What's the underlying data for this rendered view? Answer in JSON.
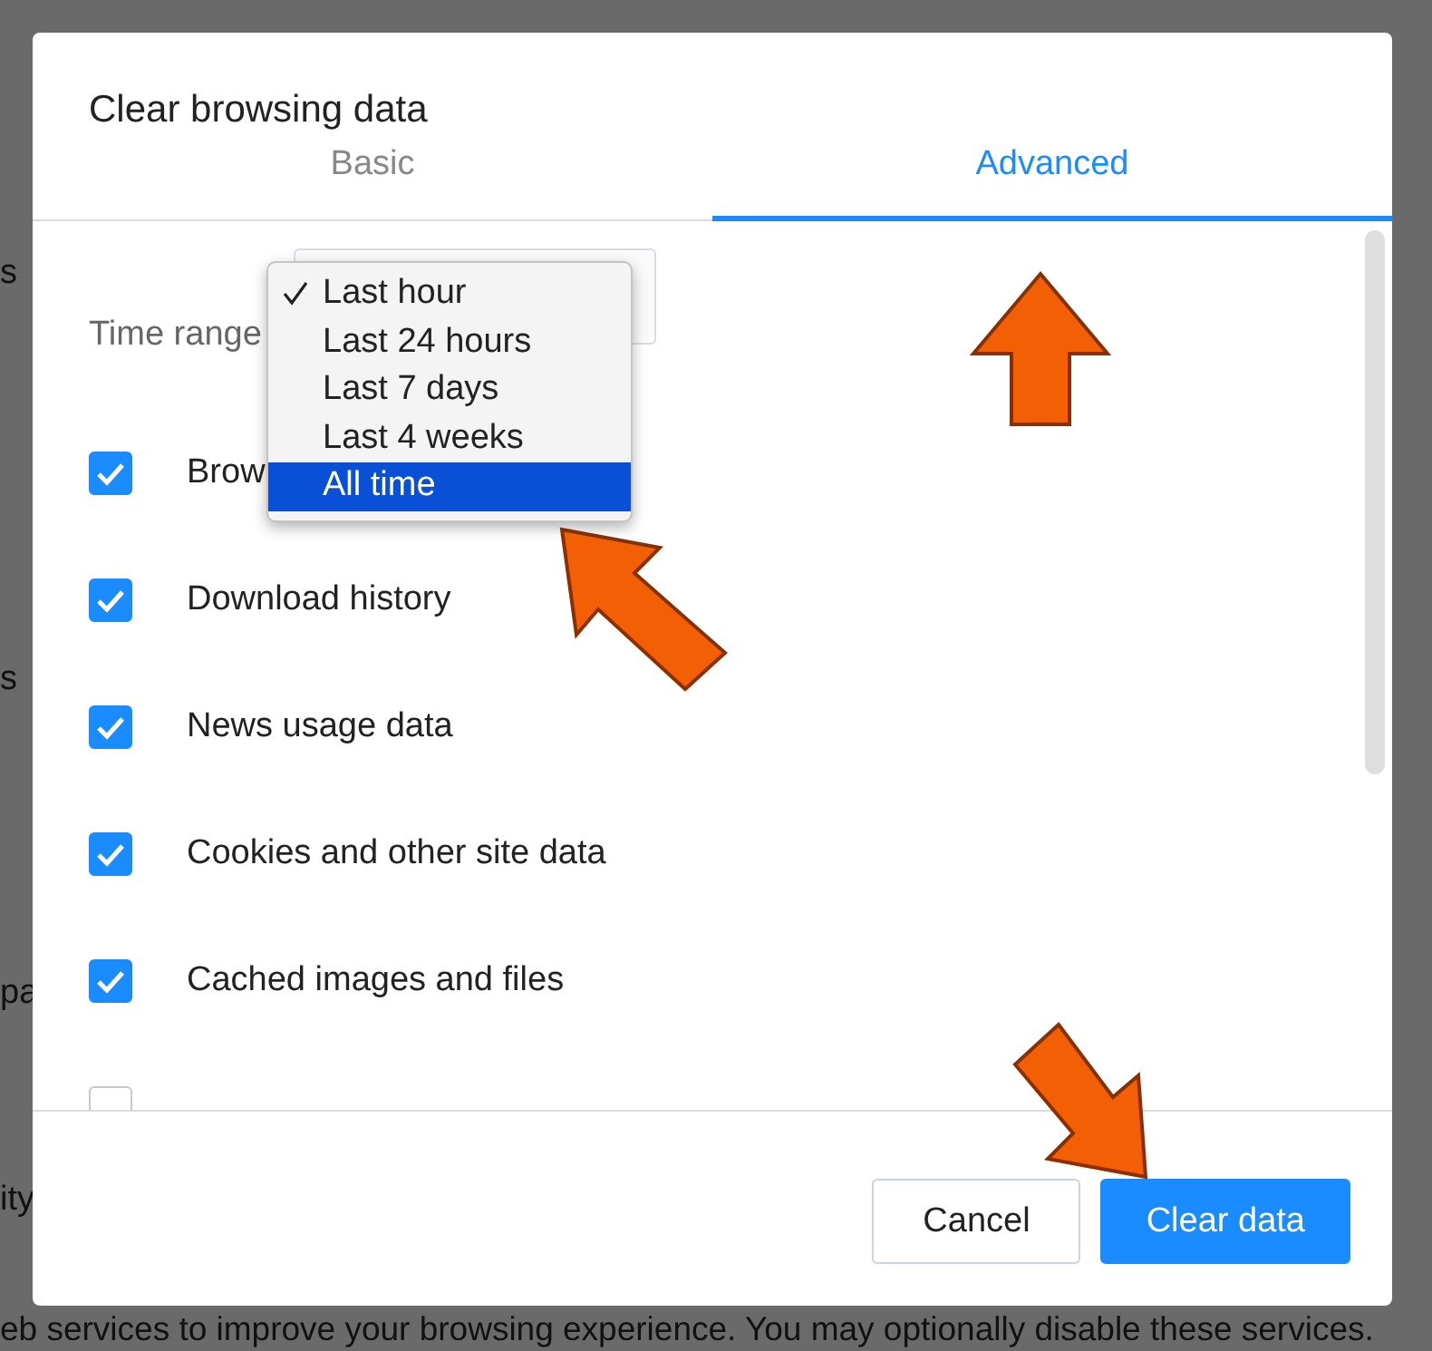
{
  "background_page": {
    "fragments": [
      {
        "text": "s"
      },
      {
        "text": "s"
      },
      {
        "text": "pa"
      },
      {
        "text": "ity"
      }
    ],
    "footer_text": "eb services to improve your browsing experience. You may optionally disable these services."
  },
  "dialog": {
    "title": "Clear browsing data",
    "tabs": [
      {
        "label": "Basic",
        "selected": false
      },
      {
        "label": "Advanced",
        "selected": true
      }
    ],
    "time_range": {
      "label": "Time range",
      "options": [
        {
          "label": "Last hour",
          "checked": true,
          "selected": false
        },
        {
          "label": "Last 24 hours",
          "checked": false,
          "selected": false
        },
        {
          "label": "Last 7 days",
          "checked": false,
          "selected": false
        },
        {
          "label": "Last 4 weeks",
          "checked": false,
          "selected": false
        },
        {
          "label": "All time",
          "checked": false,
          "selected": true
        }
      ]
    },
    "items": [
      {
        "label": "Brow",
        "checked": true
      },
      {
        "label": "Download history",
        "checked": true
      },
      {
        "label": "News usage data",
        "checked": true
      },
      {
        "label": "Cookies and other site data",
        "checked": true
      },
      {
        "label": "Cached images and files",
        "checked": true
      },
      {
        "checked": false
      }
    ],
    "buttons": [
      {
        "label": "Cancel",
        "kind": "secondary"
      },
      {
        "label": "Clear data",
        "kind": "primary"
      }
    ]
  },
  "annotations": [
    {
      "kind": "arrow"
    },
    {
      "kind": "arrow"
    },
    {
      "kind": "arrow"
    }
  ]
}
